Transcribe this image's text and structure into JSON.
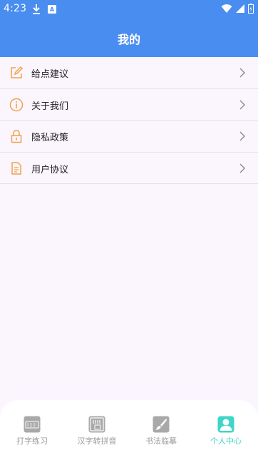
{
  "status_bar": {
    "time": "4:23",
    "a_badge": "A"
  },
  "header": {
    "title": "我的"
  },
  "menu": {
    "items": [
      {
        "label": "给点建议",
        "icon": "edit-icon"
      },
      {
        "label": "关于我们",
        "icon": "info-icon"
      },
      {
        "label": "隐私政策",
        "icon": "lock-icon"
      },
      {
        "label": "用户协议",
        "icon": "document-icon"
      }
    ]
  },
  "bottom_nav": {
    "tabs": [
      {
        "label": "打字练习",
        "icon": "keyboard-icon",
        "active": false
      },
      {
        "label": "汉字转拼音",
        "icon": "pinyin-convert-icon",
        "active": false
      },
      {
        "label": "书法临摹",
        "icon": "brush-icon",
        "active": false
      },
      {
        "label": "个人中心",
        "icon": "person-icon",
        "active": true
      }
    ]
  },
  "colors": {
    "header_bg": "#4a8df0",
    "menu_icon": "#f0a24a",
    "active_tab": "#3ed6c8",
    "inactive_tab": "#9a9a9a",
    "page_bg": "#fbf5fe"
  }
}
